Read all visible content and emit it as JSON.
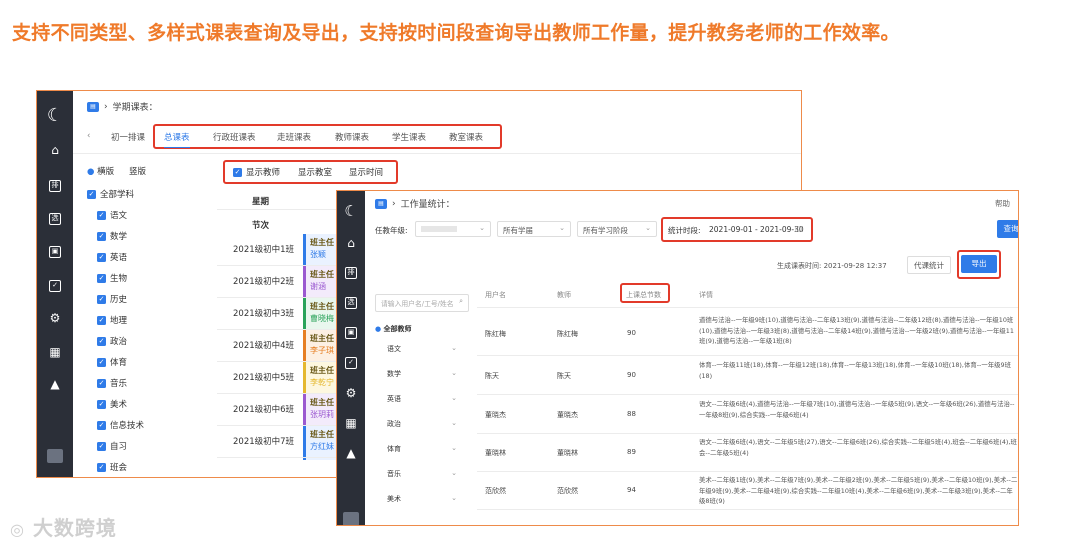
{
  "headline": "支持不同类型、多样式课表查询及导出，支持按时间段查询导出教师工作量，提升教务老师的工作效率。",
  "win1": {
    "breadcrumb": "学期课表：",
    "tabs": [
      "初一排课",
      "总课表",
      "行政班课表",
      "走班课表",
      "教师课表",
      "学生课表",
      "教室课表"
    ],
    "active_tab": "总课表",
    "layout_options": [
      "横版",
      "竖版"
    ],
    "display_options": [
      "显示教师",
      "显示教室",
      "显示时间"
    ],
    "subject_all": "全部学科",
    "subjects": [
      "语文",
      "数学",
      "英语",
      "生物",
      "历史",
      "地理",
      "政治",
      "体育",
      "音乐",
      "美术",
      "信息技术",
      "自习",
      "班会"
    ],
    "col_headers": [
      "星期",
      "节次"
    ],
    "classes": [
      "2021级初中1班",
      "2021级初中2班",
      "2021级初中3班",
      "2021级初中4班",
      "2021级初中5班",
      "2021级初中6班",
      "2021级初中7班"
    ],
    "cells": [
      {
        "title": "班主任",
        "name": "张颖",
        "color": "#2f7be8",
        "bg": "#eaf2ff"
      },
      {
        "title": "班主任",
        "name": "谢涵",
        "color": "#9b59d0",
        "bg": "#f3ebfb"
      },
      {
        "title": "班主任",
        "name": "曹晓梅",
        "color": "#2aa35a",
        "bg": "#e9f7ee"
      },
      {
        "title": "班主任",
        "name": "李子琪",
        "color": "#e67e22",
        "bg": "#fdf0e3"
      },
      {
        "title": "班主任",
        "name": "李乾宁",
        "color": "#e5b82e",
        "bg": "#fdf7df"
      },
      {
        "title": "班主任",
        "name": "张玥莉",
        "color": "#9b59d0",
        "bg": "#f3ebfb"
      },
      {
        "title": "班主任",
        "name": "方红妹",
        "color": "#2f7be8",
        "bg": "#eaf2ff"
      }
    ]
  },
  "win2": {
    "breadcrumb": "工作量统计：",
    "help": "帮助",
    "filter_label": "任教年级:",
    "filter1": "所有学届",
    "filter2": "所有学习阶段",
    "date_label": "统计时段:",
    "date_range": "2021-09-01 - 2021-09-30",
    "query_button": "查询",
    "generated": "生成课表时间: 2021-09-28 12:37",
    "btn_stats": "代课统计",
    "btn_export": "导出",
    "search_placeholder": "请输入用户名/工号/姓名",
    "teacher_all": "全部教师",
    "subjects": [
      "语文",
      "数学",
      "英语",
      "政治",
      "体育",
      "音乐",
      "美术"
    ],
    "columns": [
      "用户名",
      "教师",
      "上课总节数",
      "详情"
    ],
    "rows": [
      {
        "user": "陈红梅",
        "teacher": "陈红梅",
        "count": "90",
        "detail": "道德与法治--一年级9班(10),道德与法治--二年级13班(9),道德与法治--二年级12班(8),道德与法治--一年级10班(10),道德与法治--一年级3班(8),道德与法治--二年级14班(9),道德与法治--一年级2班(9),道德与法治--一年级11班(9),道德与法治--一年级1班(8)"
      },
      {
        "user": "陈天",
        "teacher": "陈天",
        "count": "90",
        "detail": "体育--一年级11班(18),体育--一年级12班(18),体育--一年级13班(18),体育--一年级10班(18),体育--一年级9班(18)"
      },
      {
        "user": "董晓杰",
        "teacher": "董晓杰",
        "count": "88",
        "detail": "语文--二年级6班(4),道德与法治--一年级7班(10),道德与法治--一年级5班(9),语文--一年级6班(26),道德与法治--一年级8班(9),综合实践--一年级6班(4)"
      },
      {
        "user": "董晓林",
        "teacher": "董晓林",
        "count": "89",
        "detail": "语文--二年级6班(4),语文--二年级5班(27),语文--二年级6班(26),综合实践--二年级5班(4),班会--二年级6班(4),班会--二年级5班(4)"
      },
      {
        "user": "范欣然",
        "teacher": "范欣然",
        "count": "94",
        "detail": "美术--二年级1班(9),美术--二年级7班(9),美术--二年级2班(9),美术--二年级5班(9),美术--二年级10班(9),美术--二年级9班(9),美术--二年级4班(9),综合实践--二年级10班(4),美术--二年级6班(9),美术--二年级3班(9),美术--二年级8班(9)"
      }
    ]
  },
  "watermark": "大数跨境"
}
